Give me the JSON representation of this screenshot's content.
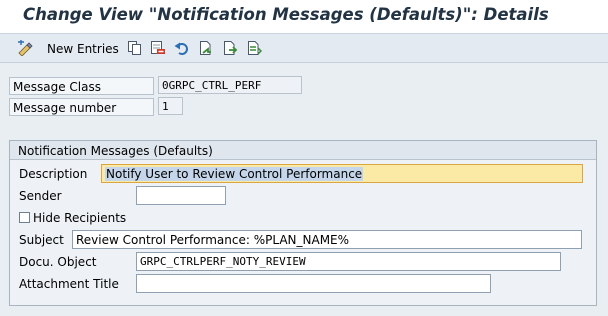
{
  "title": "Change View \"Notification Messages (Defaults)\": Details",
  "toolbar": {
    "new_entries_label": "New Entries",
    "icons": [
      "display-change-icon",
      "copy-icon",
      "delete-icon",
      "undo-icon",
      "select-all-icon",
      "previous-entry-icon",
      "next-entry-icon"
    ]
  },
  "header_fields": {
    "message_class_label": "Message Class",
    "message_class_value": "0GRPC_CTRL_PERF",
    "message_number_label": "Message number",
    "message_number_value": "1"
  },
  "group": {
    "title": "Notification Messages (Defaults)",
    "description_label": "Description",
    "description_value": "Notify User to Review Control Performance",
    "sender_label": "Sender",
    "sender_value": "",
    "hide_recipients_label": "Hide Recipients",
    "hide_recipients_checked": false,
    "subject_label": "Subject",
    "subject_value": "Review Control Performance: %PLAN_NAME%",
    "docu_object_label": "Docu. Object",
    "docu_object_value": "GRPC_CTRLPERF_NOTY_REVIEW",
    "attachment_title_label": "Attachment Title",
    "attachment_title_value": ""
  },
  "colors": {
    "accent_focus": "#fbe9a6",
    "selection": "#c5d6ea",
    "background": "#e9eef3"
  }
}
